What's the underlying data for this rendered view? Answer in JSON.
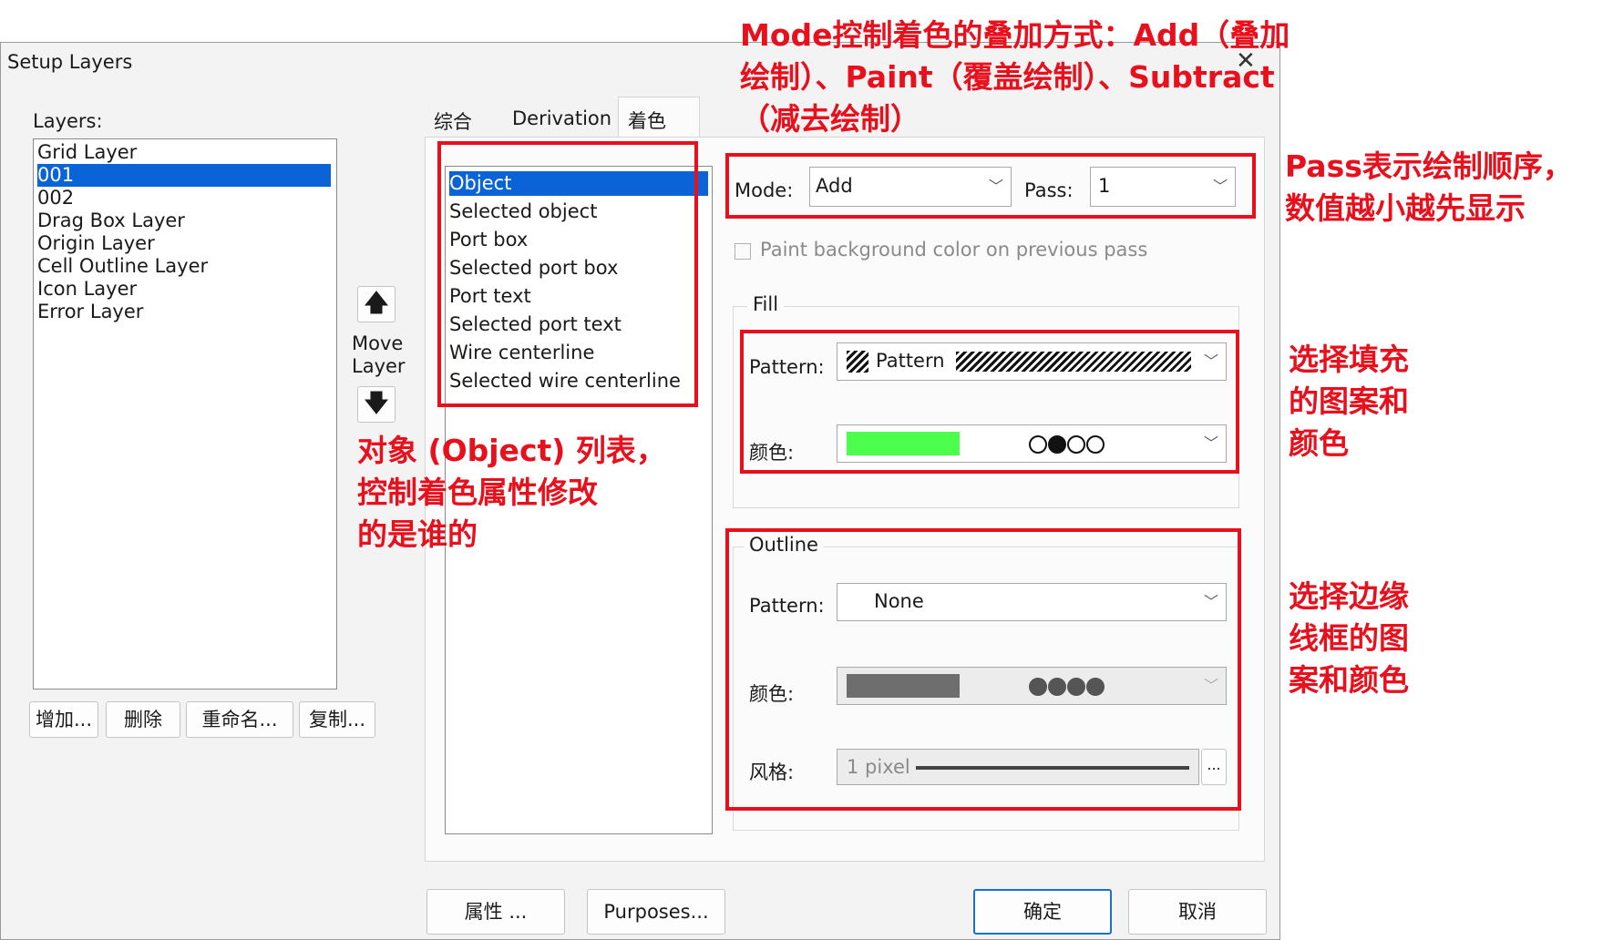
{
  "window": {
    "title": "Setup Layers"
  },
  "layers_panel": {
    "label": "Layers:",
    "items": [
      "Grid Layer",
      "001",
      "002",
      "Drag Box Layer",
      "Origin Layer",
      "Cell Outline Layer",
      "Icon Layer",
      "Error Layer"
    ],
    "selected_index": 1,
    "buttons": {
      "add": "增加...",
      "delete": "删除",
      "rename": "重命名...",
      "copy": "复制..."
    }
  },
  "move_layer": {
    "line1": "Move",
    "line2": "Layer"
  },
  "tabs": [
    "综合",
    "Derivation",
    "着色"
  ],
  "active_tab": "着色",
  "object_list": {
    "items": [
      "Object",
      "Selected object",
      "Port box",
      "Selected port box",
      "Port text",
      "Selected port text",
      "Wire centerline",
      "Selected wire centerline"
    ],
    "selected_index": 0
  },
  "mode": {
    "label": "Mode:",
    "value": "Add"
  },
  "pass": {
    "label": "Pass:",
    "value": "1"
  },
  "paint_bg_checkbox": {
    "label": "Paint background color on previous pass",
    "checked": false
  },
  "fill": {
    "group_label": "Fill",
    "pattern_label": "Pattern:",
    "pattern_value": "Pattern",
    "color_label": "颜色:",
    "color_hex": "#4cff4c"
  },
  "outline": {
    "group_label": "Outline",
    "pattern_label": "Pattern:",
    "pattern_value": "None",
    "color_label": "颜色:",
    "color_hex": "#6e6e6e",
    "style_label": "风格:",
    "style_value": "1 pixel",
    "style_button": "..."
  },
  "footer_buttons": {
    "properties": "属性 ...",
    "purposes": "Purposes...",
    "ok": "确定",
    "cancel": "取消"
  },
  "annotations": {
    "mode": [
      "Mode控制着色的叠加方式：Add（叠加",
      "绘制）、Paint（覆盖绘制）、Subtract",
      "（减去绘制）"
    ],
    "pass": [
      "Pass表示绘制顺序，",
      "数值越小越先显示"
    ],
    "object": [
      "对象 (Object) 列表，",
      "控制着色属性修改",
      "的是谁的"
    ],
    "fill": [
      "选择填充",
      "的图案和",
      "颜色"
    ],
    "outline": [
      "选择边缘",
      "线框的图",
      "案和颜色"
    ]
  },
  "accent_color": "#e8101c",
  "selection_color": "#0a64d8"
}
